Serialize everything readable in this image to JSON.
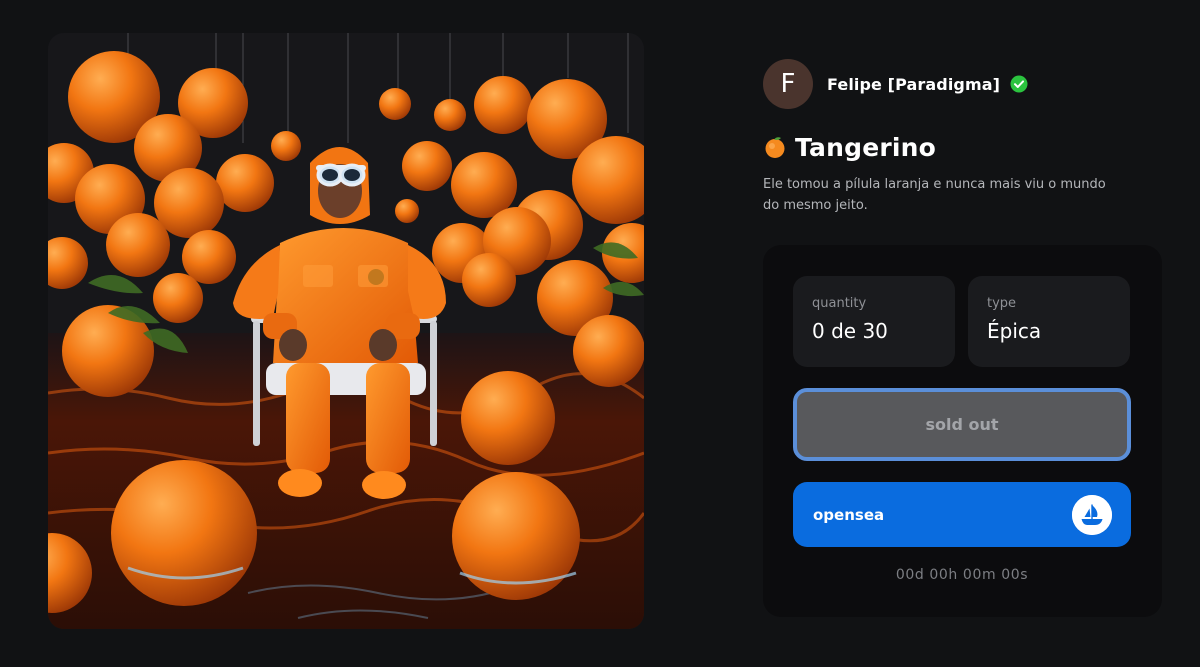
{
  "creator": {
    "avatar_initial": "F",
    "name": "Felipe [Paradigma]",
    "verified_icon": "verified-check-icon",
    "verified_color": "#2bc33f"
  },
  "item": {
    "emoji_icon": "tangerine-icon",
    "title": "Tangerino",
    "description": "Ele tomou a pílula laranja e nunca mais viu o mundo do mesmo jeito."
  },
  "stats": {
    "quantity_label": "quantity",
    "quantity_value": "0 de 30",
    "type_label": "type",
    "type_value": "Épica"
  },
  "actions": {
    "sold_out_label": "sold out",
    "opensea_label": "opensea",
    "opensea_icon": "opensea-logo-icon",
    "opensea_color": "#0a6cdf"
  },
  "countdown": "00d 00h 00m 00s",
  "artwork": {
    "icon": "nft-artwork-image",
    "accent": "#f26b12"
  }
}
